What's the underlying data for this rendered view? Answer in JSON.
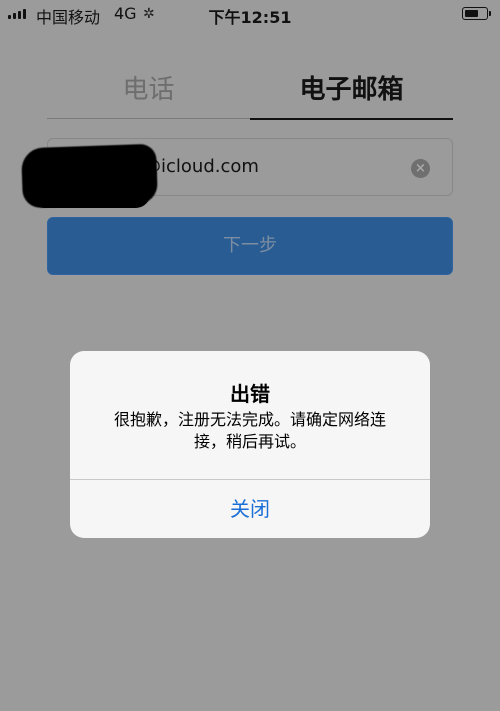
{
  "status_bar": {
    "carrier": "中国移动",
    "network": "4G",
    "time": "下午12:51",
    "battery_level": 0.5
  },
  "tabs": {
    "phone": "电话",
    "email": "电子邮箱"
  },
  "email_field": {
    "visible_value": "@icloud.com"
  },
  "next_button": {
    "label": "下一步"
  },
  "alert": {
    "title": "出错",
    "message": "很抱歉，注册无法完成。请确定网络连接，稍后再试。",
    "close_label": "关闭"
  },
  "colors": {
    "accent": "#1a6fd6",
    "button": "#285c93",
    "overlay": "#9b9b9b"
  }
}
